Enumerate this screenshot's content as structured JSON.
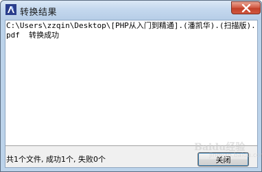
{
  "window": {
    "title": "转换结果",
    "close_icon": "close-icon",
    "app_icon": "app-logo-icon",
    "accent": "#c2412a"
  },
  "log": {
    "text": "C:\\Users\\zzqin\\Desktop\\[PHP从入门到精通].(潘凯华).(扫描版).pdf  转换成功"
  },
  "status": {
    "text": "共1个文件, 成功1个, 失败0个"
  },
  "buttons": {
    "close_label": "关闭"
  },
  "watermark": {
    "main": "Baidu经验",
    "sub": "jingyan.baidu.com"
  }
}
